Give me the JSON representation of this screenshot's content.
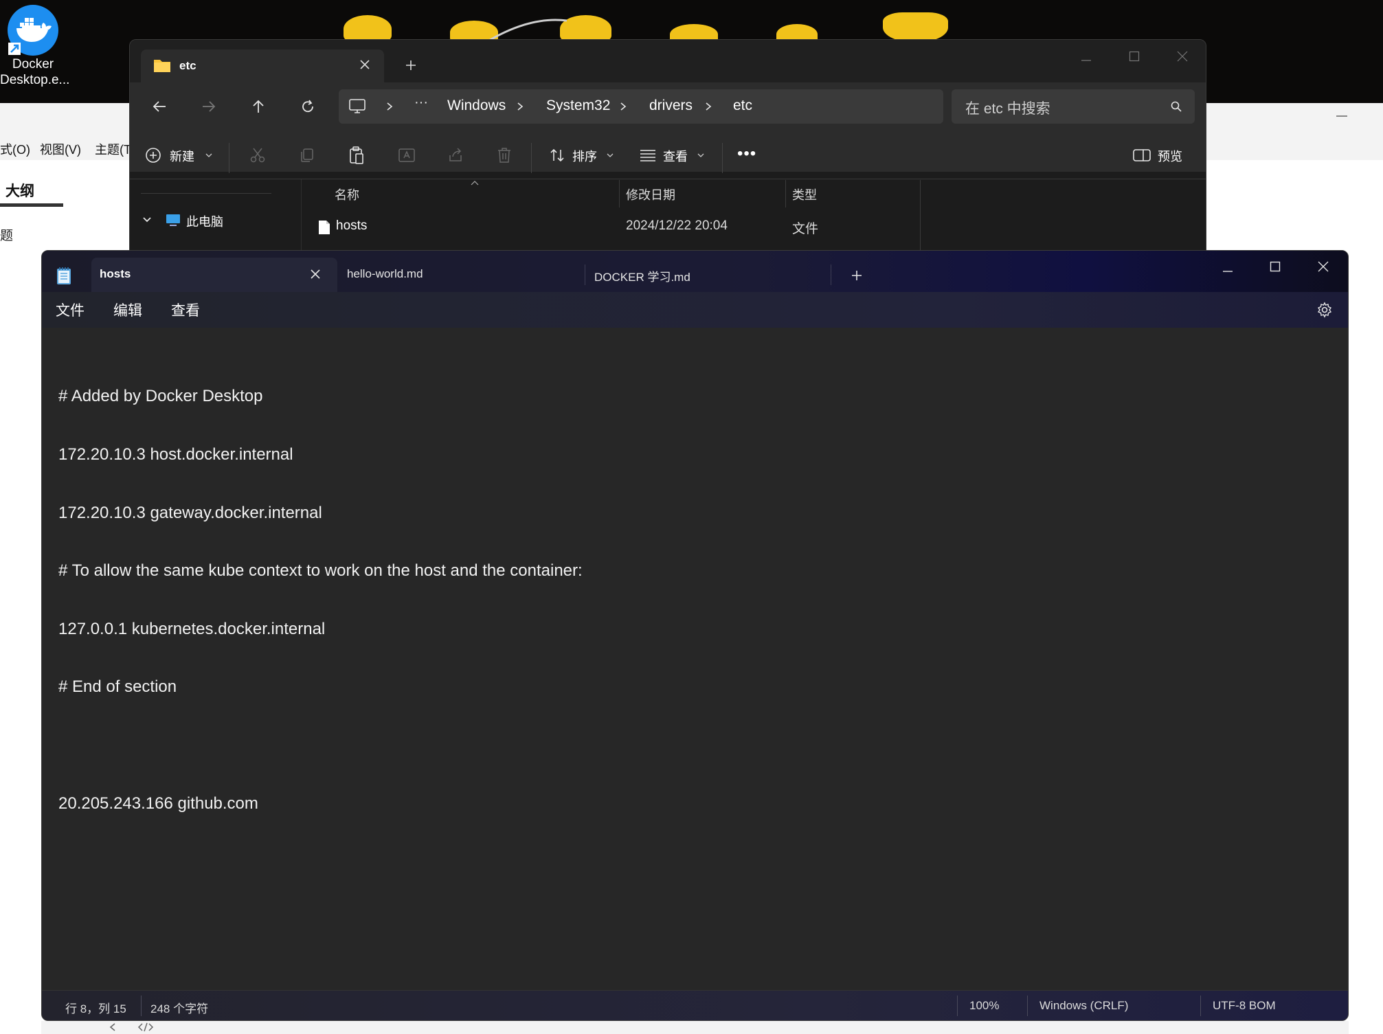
{
  "desktop": {
    "shortcut_label_line1": "Docker",
    "shortcut_label_line2": "Desktop.e..."
  },
  "background_app": {
    "menu": [
      "式(O)",
      "视图(V)",
      "主题(T"
    ],
    "outline_title": "大纲",
    "outline_item": "题"
  },
  "explorer": {
    "tab_title": "etc",
    "breadcrumb": [
      "Windows",
      "System32",
      "drivers",
      "etc"
    ],
    "search_placeholder": "在 etc 中搜索",
    "toolbar": {
      "new_label": "新建",
      "sort_label": "排序",
      "view_label": "查看",
      "preview_label": "预览"
    },
    "nav": {
      "this_pc": "此电脑"
    },
    "columns": {
      "name": "名称",
      "modified": "修改日期",
      "type": "类型"
    },
    "files": [
      {
        "name": "hosts",
        "modified": "2024/12/22 20:04",
        "type": "文件"
      }
    ]
  },
  "notepad": {
    "tabs": [
      {
        "title": "hosts",
        "active": true
      },
      {
        "title": "hello-world.md",
        "active": false
      },
      {
        "title": "DOCKER 学习.md",
        "active": false
      }
    ],
    "menu": {
      "file": "文件",
      "edit": "编辑",
      "view": "查看"
    },
    "content_lines": [
      "# Added by Docker Desktop",
      "172.20.10.3 host.docker.internal",
      "172.20.10.3 gateway.docker.internal",
      "# To allow the same kube context to work on the host and the container:",
      "127.0.0.1 kubernetes.docker.internal",
      "# End of section",
      "",
      "20.205.243.166 github.com"
    ],
    "status": {
      "position": "行 8，列 15",
      "char_count": "248 个字符",
      "zoom": "100%",
      "line_ending": "Windows (CRLF)",
      "encoding": "UTF-8 BOM"
    }
  },
  "colors": {
    "accent_folder": "#f8c33a",
    "docker_blue": "#1d8ef0",
    "desktop_glow": "#f1c21a"
  }
}
